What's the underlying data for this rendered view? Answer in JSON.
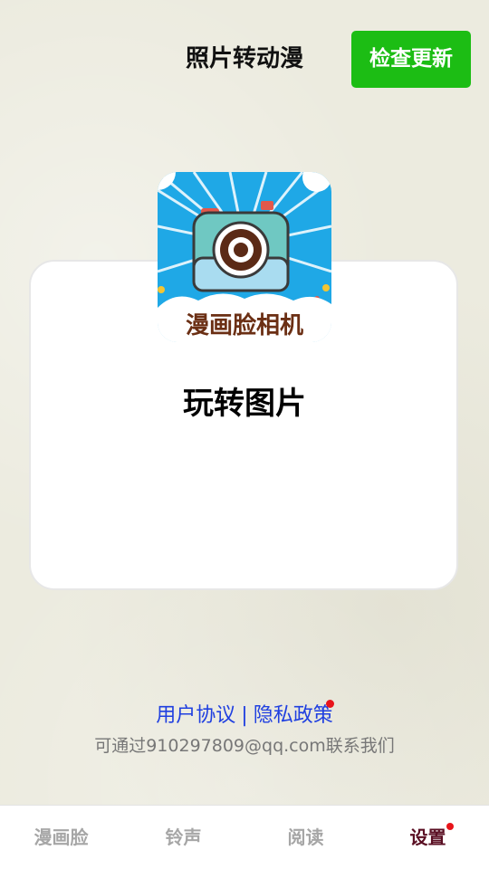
{
  "header": {
    "title": "照片转动漫",
    "update_button_label": "检查更新",
    "update_button_color": "#1cbd14"
  },
  "card": {
    "logo_text": "漫画脸相机",
    "title": "玩转图片"
  },
  "links": {
    "user_agreement": "用户协议",
    "separator": "|",
    "privacy_policy": "隐私政策",
    "privacy_has_notification": true
  },
  "contact": {
    "text": "可通过910297809@qq.com联系我们"
  },
  "tabs": [
    {
      "label": "漫画脸",
      "active": false
    },
    {
      "label": "铃声",
      "active": false
    },
    {
      "label": "阅读",
      "active": false
    },
    {
      "label": "设置",
      "active": true,
      "badge": true
    }
  ],
  "colors": {
    "link": "#1f3fe0",
    "active_tab": "#5a0f23",
    "badge": "#e8141a"
  }
}
